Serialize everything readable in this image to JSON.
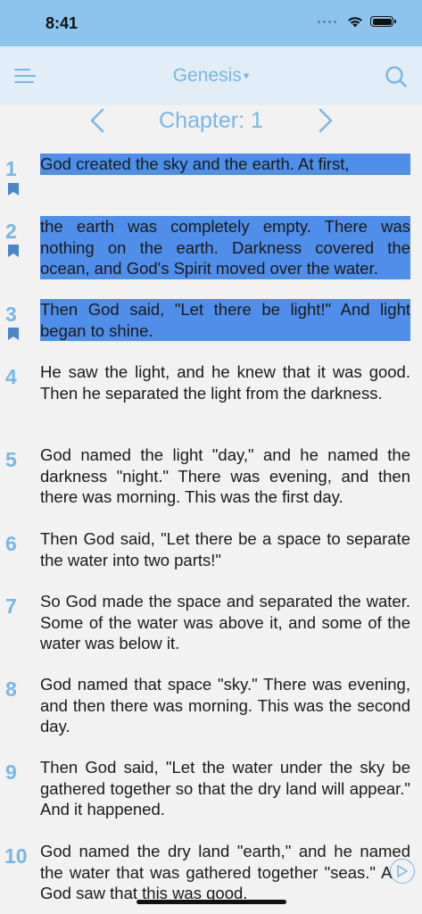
{
  "status": {
    "time": "8:41"
  },
  "nav": {
    "title": "Genesis",
    "caret": "▾"
  },
  "chapter": {
    "label": "Chapter: 1"
  },
  "verses": [
    {
      "num": "1",
      "text": "God created the sky and the earth. At first,",
      "highlighted": true,
      "bookmarked": true
    },
    {
      "num": "2",
      "text": "the earth was completely empty. There was nothing on the earth. Darkness covered the ocean, and God's Spirit moved over the water.",
      "highlighted": true,
      "bookmarked": true
    },
    {
      "num": "3",
      "text": "Then God said, \"Let there be light!\" And light began to shine.",
      "highlighted": true,
      "bookmarked": true
    },
    {
      "num": "4",
      "text": "He saw the light, and he knew that it was good. Then he separated the light from the darkness.",
      "highlighted": false,
      "bookmarked": false
    },
    {
      "num": "5",
      "text": "God named the light \"day,\" and he named the darkness \"night.\" There was evening, and then there was morning. This was the first day.",
      "highlighted": false,
      "bookmarked": false
    },
    {
      "num": "6",
      "text": "Then God said, \"Let there be a space to separate the water into two parts!\"",
      "highlighted": false,
      "bookmarked": false
    },
    {
      "num": "7",
      "text": "So God made the space and separated the water. Some of the water was above it, and some of the water was below it.",
      "highlighted": false,
      "bookmarked": false
    },
    {
      "num": "8",
      "text": "God named that space \"sky.\" There was evening, and then there was morning. This was the second day.",
      "highlighted": false,
      "bookmarked": false
    },
    {
      "num": "9",
      "text": "Then God said, \"Let the water under the sky be gathered together so that the dry land will appear.\" And it happened.",
      "highlighted": false,
      "bookmarked": false
    },
    {
      "num": "10",
      "text": "God named the dry land \"earth,\" and he named the water that was gathered together \"seas.\" And God saw that this was good.",
      "highlighted": false,
      "bookmarked": false
    }
  ],
  "colors": {
    "accent": "#7ab6e4",
    "highlight": "#4f8ee9",
    "status_bar": "#8cc4ee",
    "nav_bar": "#e1eef8"
  },
  "icons": {
    "menu": "menu-lines-icon",
    "search": "search-icon",
    "prev": "chevron-left-icon",
    "next": "chevron-right-icon",
    "bookmark": "bookmark-icon",
    "play": "play-icon"
  }
}
